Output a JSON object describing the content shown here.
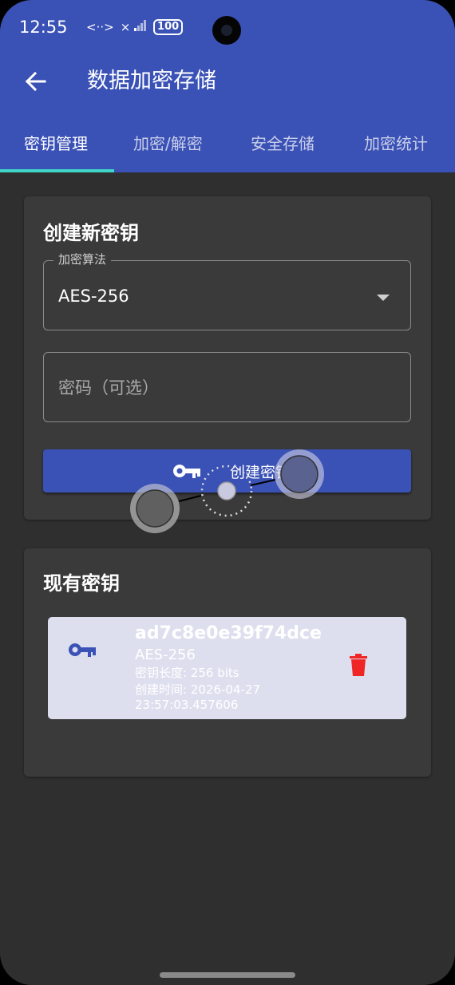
{
  "status_bar": {
    "time": "12:55",
    "network": "<··>",
    "signal": "×",
    "battery": "100"
  },
  "app_bar": {
    "title": "数据加密存储"
  },
  "tabs": [
    {
      "label": "密钥管理",
      "active": true
    },
    {
      "label": "加密/解密",
      "active": false
    },
    {
      "label": "安全存储",
      "active": false
    },
    {
      "label": "加密统计",
      "active": false
    }
  ],
  "create_key": {
    "title": "创建新密钥",
    "algorithm_label": "加密算法",
    "algorithm_value": "AES-256",
    "password_placeholder": "密码（可选）",
    "button_label": "创建密钥"
  },
  "existing_keys": {
    "title": "现有密钥",
    "items": [
      {
        "id": "ad7c8e0e39f74dce",
        "algorithm": "AES-256",
        "key_length": "密钥长度: 256 bits",
        "created": "创建时间: 2026-04-27",
        "created_time": "23:57:03.457606"
      }
    ]
  },
  "colors": {
    "primary": "#3a51b5",
    "tab_indicator": "#40d6c7",
    "background": "#2f2f2f",
    "card": "#3a3a3a",
    "key_item_bg": "#dedfee",
    "delete": "#f02525"
  },
  "icons": [
    "back-arrow-icon",
    "key-icon",
    "delete-icon",
    "dropdown-caret-icon"
  ]
}
